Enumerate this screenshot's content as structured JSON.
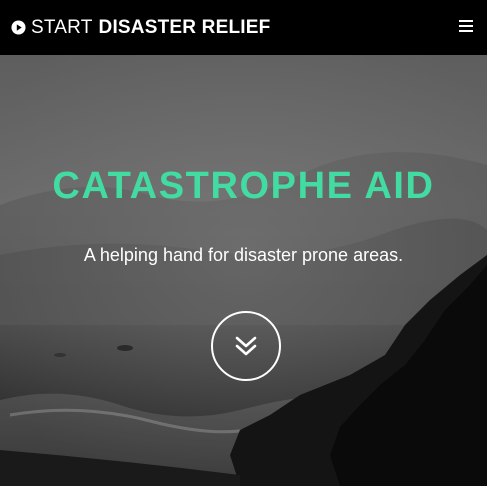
{
  "navbar": {
    "brand_light": "START",
    "brand_bold": "DISASTER RELIEF",
    "brand_icon": "play-circle-icon",
    "menu_icon": "hamburger-menu-icon"
  },
  "hero": {
    "title": "CATASTROPHE AID",
    "subtitle": "A helping hand for disaster prone areas.",
    "scroll_icon": "double-chevron-down-icon"
  },
  "colors": {
    "accent": "#42dca3",
    "navbar_bg": "#000000",
    "text": "#ffffff"
  }
}
